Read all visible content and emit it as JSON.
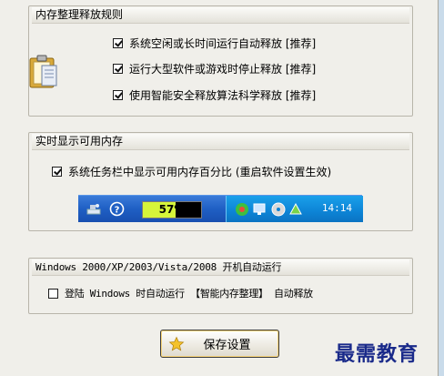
{
  "rules_group": {
    "title": "内存整理释放规则",
    "options": [
      {
        "label": "系统空闲或长时间运行自动释放 [推荐]",
        "checked": true
      },
      {
        "label": "运行大型软件或游戏时停止释放 [推荐]",
        "checked": true
      },
      {
        "label": "使用智能安全释放算法科学释放 [推荐]",
        "checked": true
      }
    ]
  },
  "realtime_group": {
    "title": "实时显示可用内存",
    "option": {
      "label": "系统任务栏中显示可用内存百分比 (重启软件设置生效)",
      "checked": true
    },
    "preview": {
      "percent_text": "57%",
      "percent_value": 57,
      "clock": "14:14"
    }
  },
  "autostart_group": {
    "title": "Windows 2000/XP/2003/Vista/2008 开机自动运行",
    "option": {
      "label": "登陆 Windows 时自动运行 【智能内存整理】 自动释放",
      "checked": false
    }
  },
  "save_button": {
    "label": "保存设置"
  },
  "watermark": "最需教育",
  "colors": {
    "panel_bg": "#f0efea",
    "taskbar_blue": "#1f5fc4",
    "tray_blue": "#0d84d6",
    "meter_fill": "#d6f53a"
  }
}
